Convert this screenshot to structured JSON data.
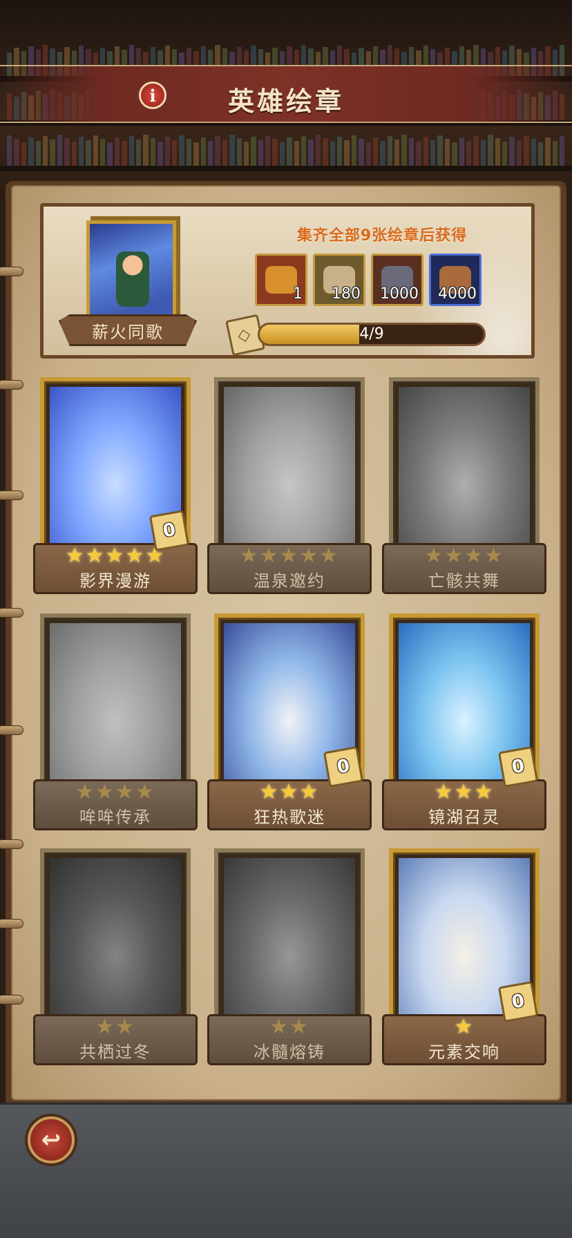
{
  "header": {
    "title": "英雄绘章",
    "info_icon": "info-icon"
  },
  "album": {
    "name": "薪火同歌",
    "reward_caption": "集齐全部9张绘章后获得",
    "rewards": [
      {
        "icon": "gold-coin-bag-icon",
        "count": "1",
        "color": "#d8902e"
      },
      {
        "icon": "scroll-icon",
        "count": "180",
        "color": "#c8b08a"
      },
      {
        "icon": "iron-ore-icon",
        "count": "1000",
        "color": "#6a6a7a"
      },
      {
        "icon": "copper-ore-icon",
        "count": "4000",
        "color": "#a96b3c"
      }
    ],
    "progress_text": "4/9",
    "progress_fraction": 0.444
  },
  "cards": [
    {
      "name": "影界漫游",
      "stars": "★★★★★",
      "stars_lit": true,
      "count": "0",
      "collected": true,
      "art_colors": [
        "#3b56c9",
        "#7fa7ff",
        "#c7dcff"
      ]
    },
    {
      "name": "温泉邀约",
      "stars": "★★★★★",
      "stars_lit": false,
      "count": "",
      "collected": false,
      "art_colors": [
        "#6d7a80",
        "#b6c0c4",
        "#e6e9ea"
      ]
    },
    {
      "name": "亡骸共舞",
      "stars": "★★★★",
      "stars_lit": false,
      "count": "",
      "collected": false,
      "art_colors": [
        "#4a5260",
        "#8791a0",
        "#c7ced6"
      ]
    },
    {
      "name": "哞哞传承",
      "stars": "★★★★",
      "stars_lit": false,
      "count": "",
      "collected": false,
      "art_colors": [
        "#7a8086",
        "#b7bcc0",
        "#e0e2e4"
      ]
    },
    {
      "name": "狂热歌迷",
      "stars": "★★★",
      "stars_lit": true,
      "count": "0",
      "collected": true,
      "art_colors": [
        "#3a4e9a",
        "#8fb6e8",
        "#f1f3f7"
      ]
    },
    {
      "name": "镜湖召灵",
      "stars": "★★★",
      "stars_lit": true,
      "count": "0",
      "collected": true,
      "art_colors": [
        "#2a6dc0",
        "#7cc4f0",
        "#d9f1ff"
      ]
    },
    {
      "name": "共栖过冬",
      "stars": "★★",
      "stars_lit": false,
      "count": "",
      "collected": false,
      "art_colors": [
        "#3a3a38",
        "#6c665e",
        "#a39a8c"
      ]
    },
    {
      "name": "冰髓熔铸",
      "stars": "★★",
      "stars_lit": false,
      "count": "",
      "collected": false,
      "art_colors": [
        "#3c4450",
        "#717c88",
        "#a9b3bd"
      ]
    },
    {
      "name": "元素交响",
      "stars": "★",
      "stars_lit": true,
      "count": "0",
      "collected": true,
      "art_colors": [
        "#5f7fb8",
        "#c9d8f0",
        "#f5efe6"
      ]
    }
  ],
  "footer": {
    "back_icon": "back-arrow-icon",
    "back_glyph": "↩"
  }
}
